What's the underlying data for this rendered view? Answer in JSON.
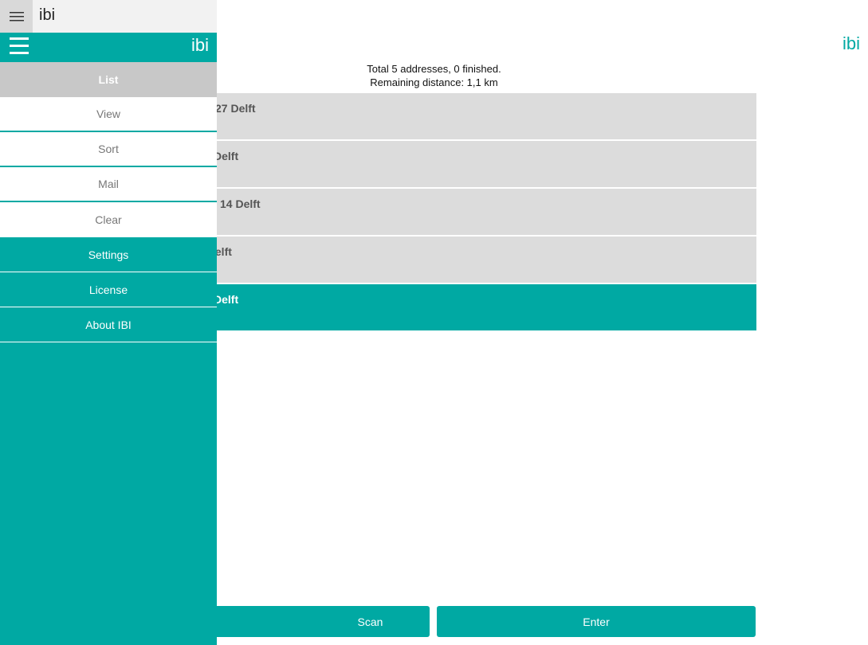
{
  "window": {
    "title": "ibi"
  },
  "logo": "ibi",
  "summary": {
    "line1": "Total 5 addresses, 0 finished.",
    "line2": "Remaining distance: 1,1 km"
  },
  "addresses": [
    {
      "text": "27 Delft",
      "active": false
    },
    {
      "text": "Delft",
      "active": false
    },
    {
      "text": "14 Delft",
      "active": false
    },
    {
      "text": "lelft",
      "active": false
    },
    {
      "text": "Delft",
      "active": true
    }
  ],
  "buttons": {
    "scan": "Scan",
    "enter": "Enter"
  },
  "drawer": {
    "logo": "ibi",
    "items": [
      {
        "label": "List"
      },
      {
        "label": "View"
      },
      {
        "label": "Sort"
      },
      {
        "label": "Mail"
      },
      {
        "label": "Clear"
      },
      {
        "label": "Settings"
      },
      {
        "label": "License"
      },
      {
        "label": "About IBI"
      }
    ]
  },
  "colors": {
    "accent": "#00a9a3",
    "row": "#dcdcdc",
    "selected": "#c8c8c8"
  },
  "icons": {
    "menu": "hamburger-icon"
  }
}
